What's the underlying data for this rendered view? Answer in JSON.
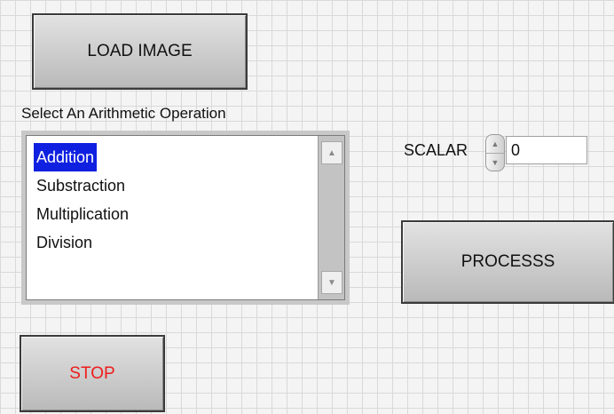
{
  "buttons": {
    "load_image": "LOAD IMAGE",
    "process": "PROCESSS",
    "stop": "STOP"
  },
  "operation": {
    "label": "Select An Arithmetic Operation",
    "items": [
      "Addition",
      "Substraction",
      "Multiplication",
      "Division"
    ],
    "selected": "Addition"
  },
  "scalar": {
    "label": "SCALAR",
    "value": "0"
  },
  "colors": {
    "selection": "#1020e0",
    "stop_text": "#ee1c1c"
  }
}
